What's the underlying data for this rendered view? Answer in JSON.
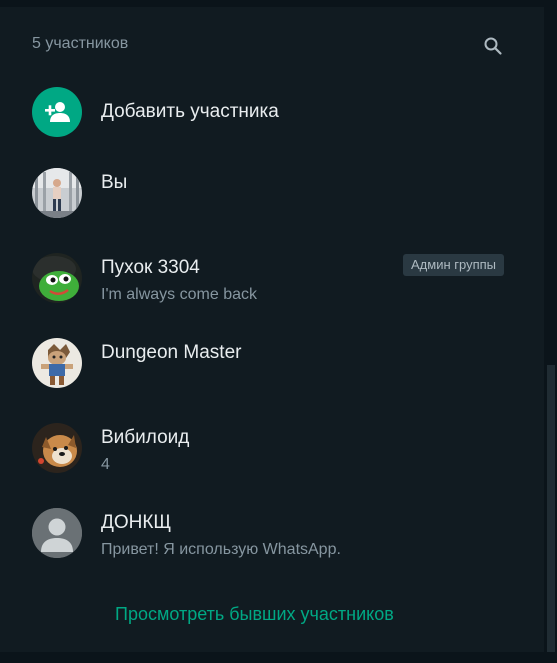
{
  "header": {
    "participants_count": "5 участников",
    "search_icon": "search-icon"
  },
  "add_participant": {
    "label": "Добавить участника",
    "icon": "add-person-icon",
    "accent": "#00a884"
  },
  "participants": [
    {
      "name": "Вы",
      "status": ""
    },
    {
      "name": "Пухок 3304",
      "status": "I'm always come back",
      "badge": "Админ группы"
    },
    {
      "name": "Dungeon Master",
      "status": ""
    },
    {
      "name": "Вибилоид",
      "status": "4"
    },
    {
      "name": "ДОНКЩ",
      "status": "Привет! Я использую WhatsApp."
    }
  ],
  "footer": {
    "view_former_label": "Просмотреть бывших участников"
  },
  "colors": {
    "panel_bg": "#111b21",
    "app_bg": "#0b141a",
    "text_primary": "#e9edef",
    "text_secondary": "#8696a0",
    "accent": "#00a884"
  }
}
